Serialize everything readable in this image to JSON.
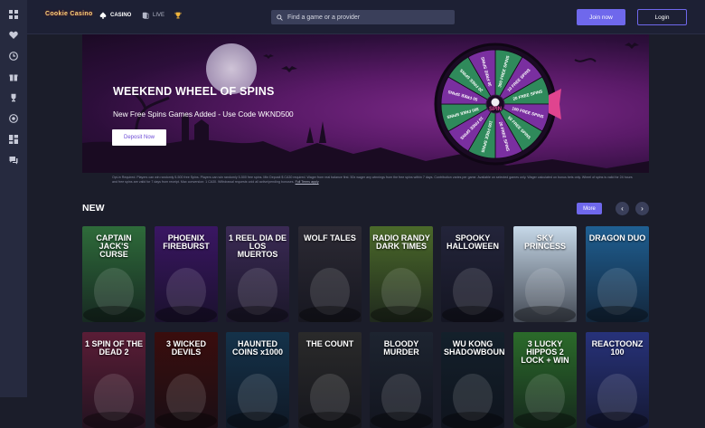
{
  "sidebar": {
    "items": [
      {
        "icon": "grid-icon"
      },
      {
        "icon": "heart-icon"
      },
      {
        "icon": "clock-icon"
      },
      {
        "icon": "gift-icon"
      },
      {
        "icon": "trophy-icon"
      },
      {
        "icon": "target-icon"
      },
      {
        "icon": "layout-icon"
      },
      {
        "icon": "chat-icon"
      }
    ]
  },
  "header": {
    "logo_text": "Cookie Casino",
    "nav": {
      "casino_label": "CASINO",
      "live_label": "LIVE"
    },
    "search_placeholder": "Find a game or a provider",
    "join_label": "Join now",
    "login_label": "Login"
  },
  "hero": {
    "title": "WEEKEND WHEEL OF SPINS",
    "subtitle": "New Free Spins Games Added - Use Code WKND500",
    "button_label": "Deposit Now",
    "wheel": {
      "center_label": "SPIN",
      "segments": [
        "300 FREE SPINS",
        "10 FREE SPINS",
        "20 FREE SPINS",
        "100 FREE SPINS",
        "50 FREE SPINS",
        "20 FREE SPINS",
        "100 FREE SPINS",
        "10 FREE SPINS",
        "300 FREE SPINS",
        "50 FREE SPINS",
        "20 FREE SPINS",
        "30 FREE SPINS"
      ]
    },
    "disclaimer": "Opt-in Required. Players can win randomly 5-500 free Spins. Players can win randomly 5-500 free spins. Min Deposit $ CA30 required. Wager from real balance first. 50x wager any winnings from the free spins within 7 days. Contribution varies per game. Available on selected games only. Wager calculated on bonus bets only. Wheel of spins is valid for 24 hours and free spins are valid for 7 days from receipt. Max conversion: 1 CA30. Withdrawal requests void all active/pending bonuses.",
    "disclaimer_link": "Full Terms apply"
  },
  "section": {
    "title": "NEW",
    "more_label": "More",
    "prev_label": "‹",
    "next_label": "›"
  },
  "games_row1": [
    {
      "name": "CAPTAIN JACK'S CURSE",
      "bg": "#2e6b3a"
    },
    {
      "name": "PHOENIX FIREBURST",
      "bg": "#3a1663"
    },
    {
      "name": "1 REEL DIA DE LOS MUERTOS",
      "bg": "#3b2a55"
    },
    {
      "name": "WOLF TALES",
      "bg": "#2c2a34"
    },
    {
      "name": "RADIO RANDY DARK TIMES",
      "bg": "#4b6a2a"
    },
    {
      "name": "SPOOKY HALLOWEEN",
      "bg": "#23243a"
    },
    {
      "name": "SKY PRINCESS",
      "bg": "#c6d8e8"
    },
    {
      "name": "DRAGON DUO",
      "bg": "#1f5f92"
    }
  ],
  "games_row2": [
    {
      "name": "1 SPIN OF THE DEAD 2",
      "bg": "#5a1d36"
    },
    {
      "name": "3 WICKED DEVILS",
      "bg": "#3a0d0d"
    },
    {
      "name": "HAUNTED COINS x1000",
      "bg": "#14324a"
    },
    {
      "name": "THE COUNT",
      "bg": "#2a2a2a"
    },
    {
      "name": "BLOODY MURDER",
      "bg": "#1d2430"
    },
    {
      "name": "WU KONG SHADOWBOUND",
      "bg": "#13202b"
    },
    {
      "name": "3 LUCKY HIPPOS 2 LOCK + WIN",
      "bg": "#2b6b2a"
    },
    {
      "name": "REACTOONZ 100",
      "bg": "#27327a"
    }
  ],
  "colors": {
    "accent": "#6f68ec",
    "background": "#1b1d2a",
    "rail": "#262a3f"
  }
}
